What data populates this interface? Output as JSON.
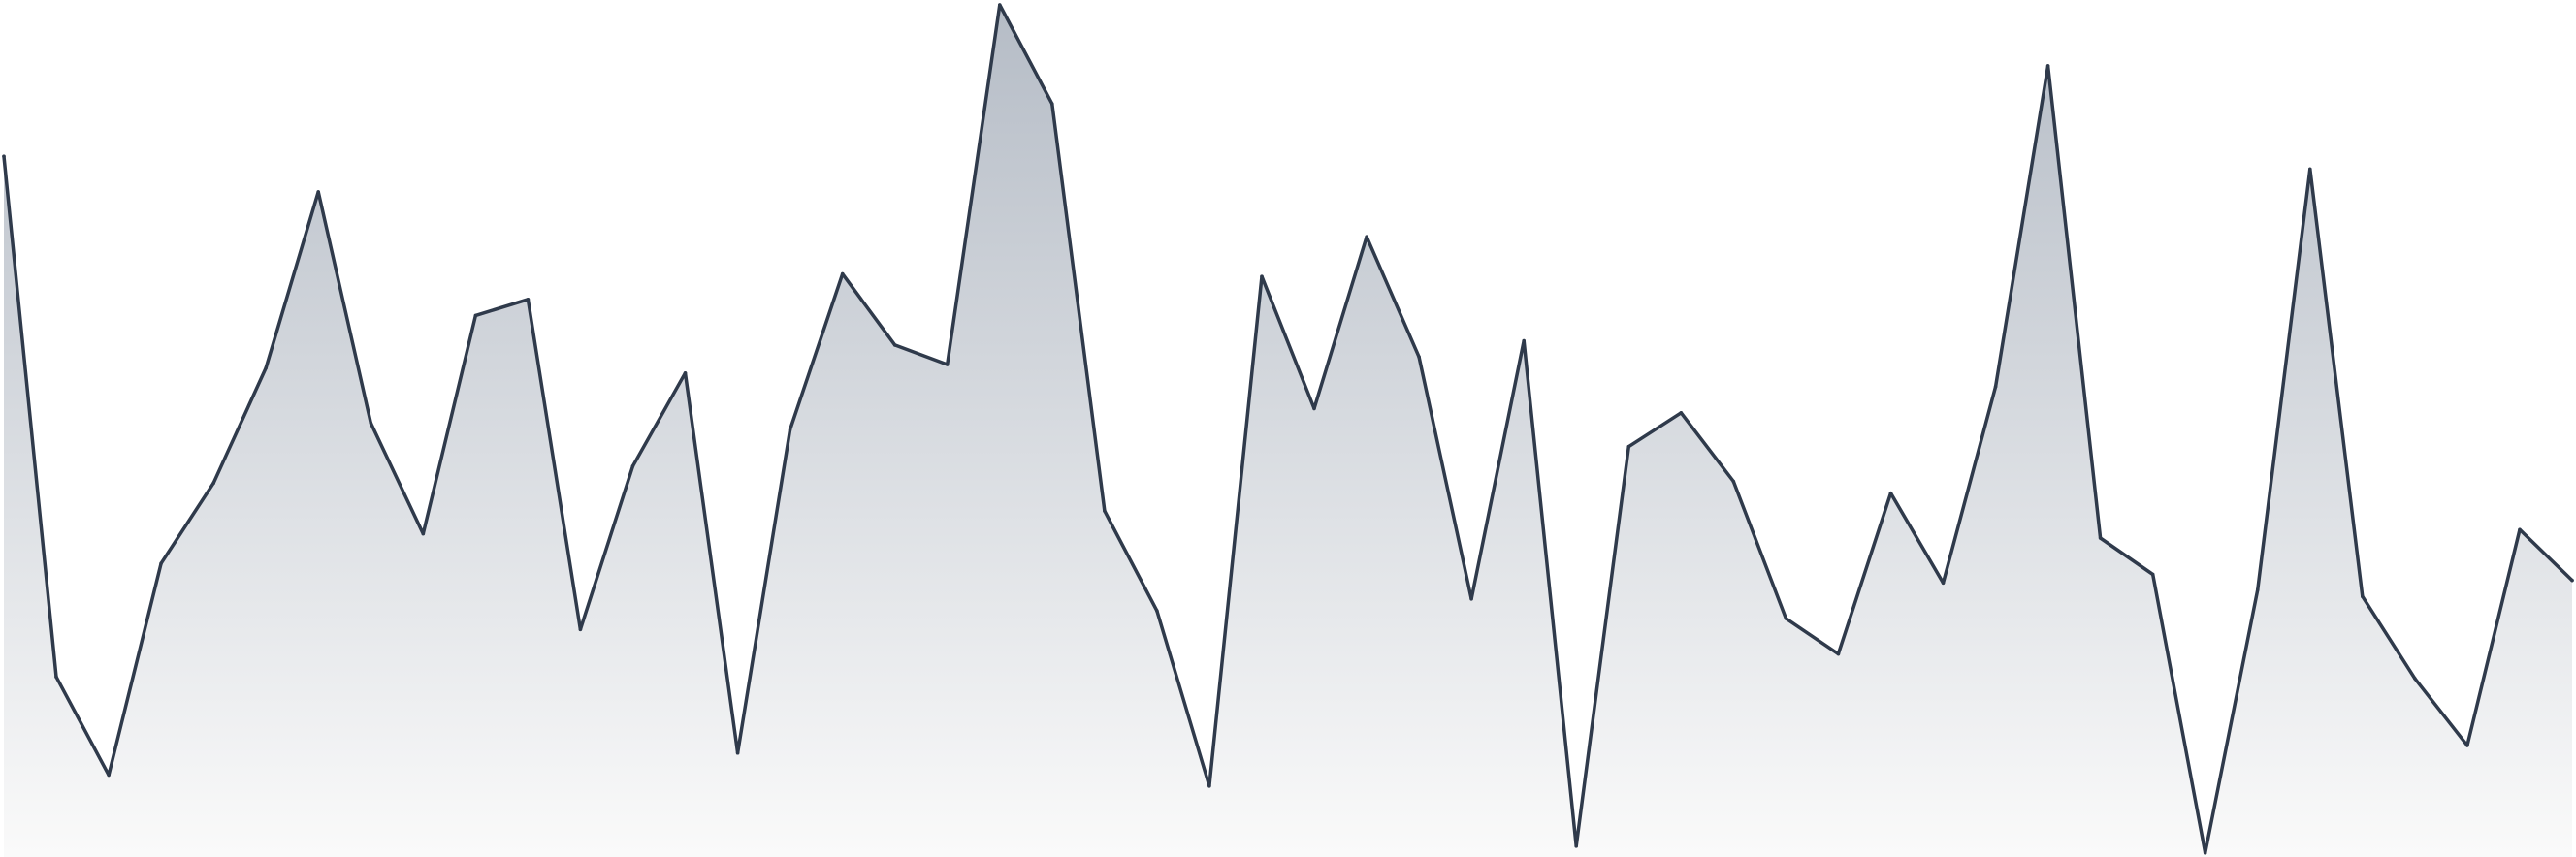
{
  "colors": {
    "line": "#2f3a4b",
    "fill_top": "#b5bcc6",
    "fill_bottom": "#fafafa",
    "background": "#ffffff"
  },
  "chart_data": {
    "type": "area",
    "title": "",
    "xlabel": "",
    "ylabel": "",
    "x": [
      0,
      1,
      2,
      3,
      4,
      5,
      6,
      7,
      8,
      9,
      10,
      11,
      12,
      13,
      14,
      15,
      16,
      17,
      18,
      19,
      20,
      21,
      22,
      23,
      24,
      25,
      26,
      27,
      28,
      29,
      30,
      31,
      32,
      33,
      34,
      35,
      36,
      37,
      38,
      39,
      40,
      41,
      42,
      43,
      44,
      45,
      46,
      47,
      48,
      49
    ],
    "series": [
      {
        "values": [
          82.1,
          20.6,
          9.0,
          34.0,
          43.5,
          57.1,
          77.9,
          50.6,
          37.5,
          63.3,
          65.2,
          26.2,
          45.5,
          56.5,
          11.6,
          49.8,
          68.2,
          59.8,
          57.5,
          100.0,
          88.3,
          40.2,
          28.4,
          7.7,
          67.9,
          52.3,
          72.6,
          58.4,
          29.8,
          60.3,
          0.6,
          47.8,
          51.8,
          43.7,
          27.5,
          23.3,
          42.3,
          31.7,
          54.9,
          92.8,
          37.0,
          32.7,
          -0.2,
          30.9,
          80.6,
          30.1,
          20.4,
          12.5,
          38.0,
          32.0
        ]
      }
    ],
    "ylim": [
      0,
      100
    ],
    "grid": false,
    "legend": "none"
  }
}
